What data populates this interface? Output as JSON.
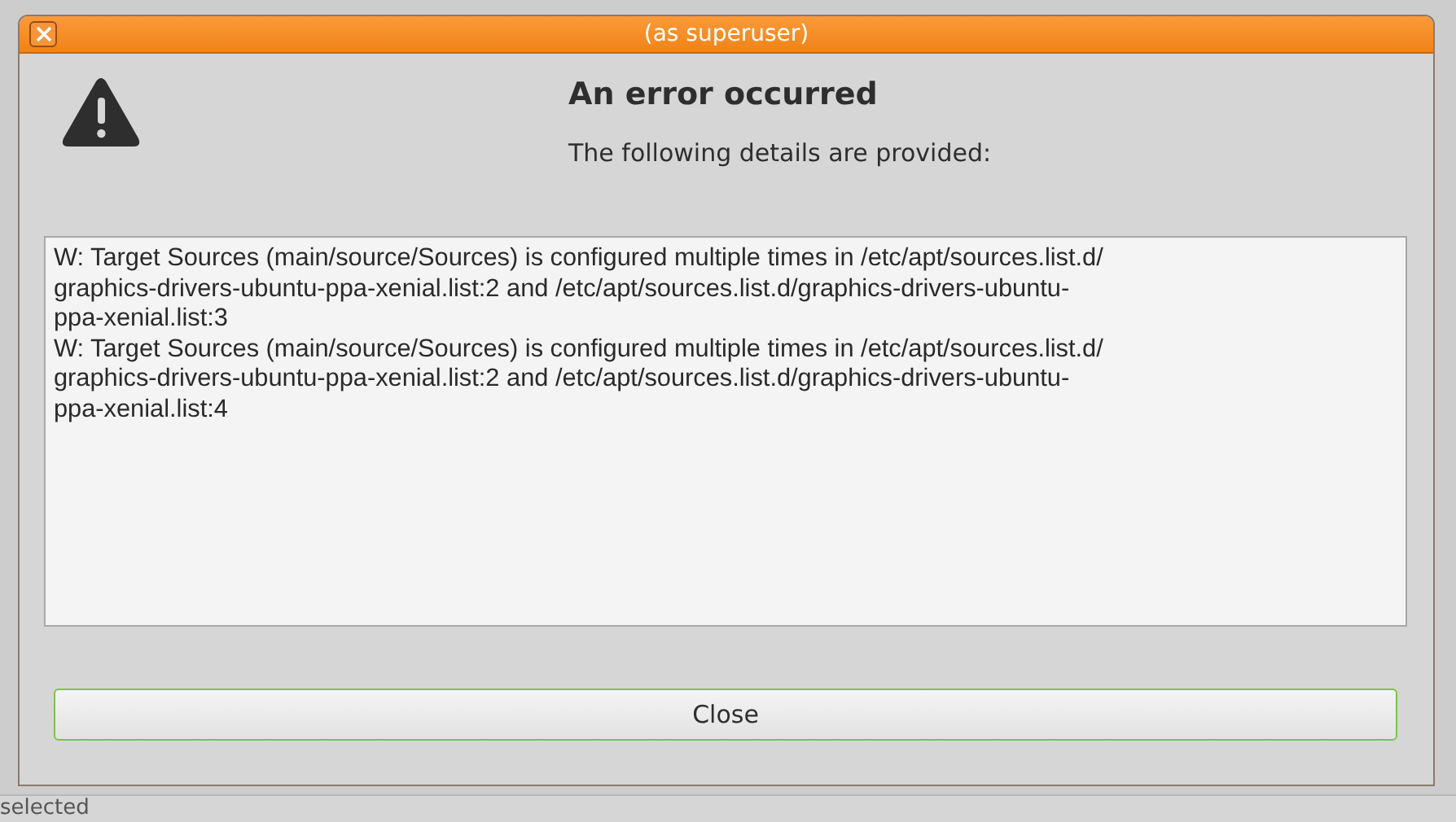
{
  "window": {
    "title": "(as superuser)"
  },
  "heading": "An error occurred",
  "subheading": "The following details are provided:",
  "details_lines": [
    "W: Target Sources (main/source/Sources) is configured multiple times in /etc/apt/sources.list.d/",
    "graphics-drivers-ubuntu-ppa-xenial.list:2 and /etc/apt/sources.list.d/graphics-drivers-ubuntu-",
    "ppa-xenial.list:3",
    "W: Target Sources (main/source/Sources) is configured multiple times in /etc/apt/sources.list.d/",
    "graphics-drivers-ubuntu-ppa-xenial.list:2 and /etc/apt/sources.list.d/graphics-drivers-ubuntu-",
    "ppa-xenial.list:4"
  ],
  "buttons": [
    "Close"
  ],
  "status_bar": "selected"
}
